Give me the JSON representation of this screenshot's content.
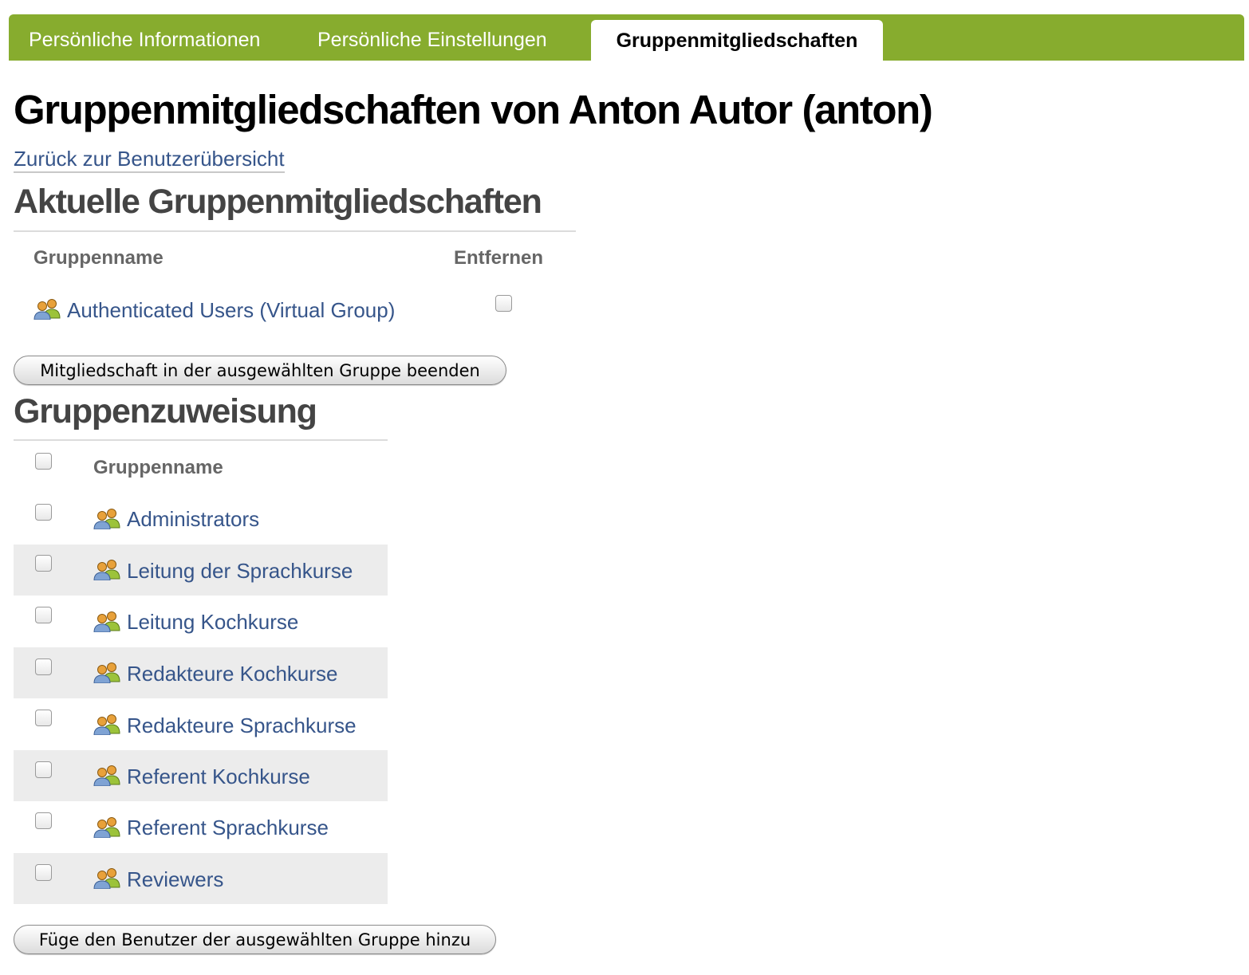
{
  "tabs": [
    {
      "label": "Persönliche Informationen",
      "active": false
    },
    {
      "label": "Persönliche Einstellungen",
      "active": false
    },
    {
      "label": "Gruppenmitgliedschaften",
      "active": true
    }
  ],
  "page_title": "Gruppenmitgliedschaften von Anton Autor (anton)",
  "back_link": "Zurück zur Benutzerübersicht",
  "current": {
    "heading": "Aktuelle Gruppenmitgliedschaften",
    "col_name": "Gruppenname",
    "col_remove": "Entfernen",
    "groups": [
      {
        "name": "Authenticated Users (Virtual Group)",
        "checked": false
      }
    ],
    "button": "Mitgliedschaft in der ausgewählten Gruppe beenden"
  },
  "assign": {
    "heading": "Gruppenzuweisung",
    "col_name": "Gruppenname",
    "select_all_checked": false,
    "groups": [
      {
        "name": "Administrators",
        "checked": false
      },
      {
        "name": "Leitung der Sprachkurse",
        "checked": false
      },
      {
        "name": "Leitung Kochkurse",
        "checked": false
      },
      {
        "name": "Redakteure Kochkurse",
        "checked": false
      },
      {
        "name": "Redakteure Sprachkurse",
        "checked": false
      },
      {
        "name": "Referent Kochkurse",
        "checked": false
      },
      {
        "name": "Referent Sprachkurse",
        "checked": false
      },
      {
        "name": "Reviewers",
        "checked": false
      }
    ],
    "button": "Füge den Benutzer der ausgewählten Gruppe hinzu"
  },
  "colors": {
    "tabbar": "#87ac2e",
    "link": "#36558a",
    "row_alt": "#ececec"
  }
}
